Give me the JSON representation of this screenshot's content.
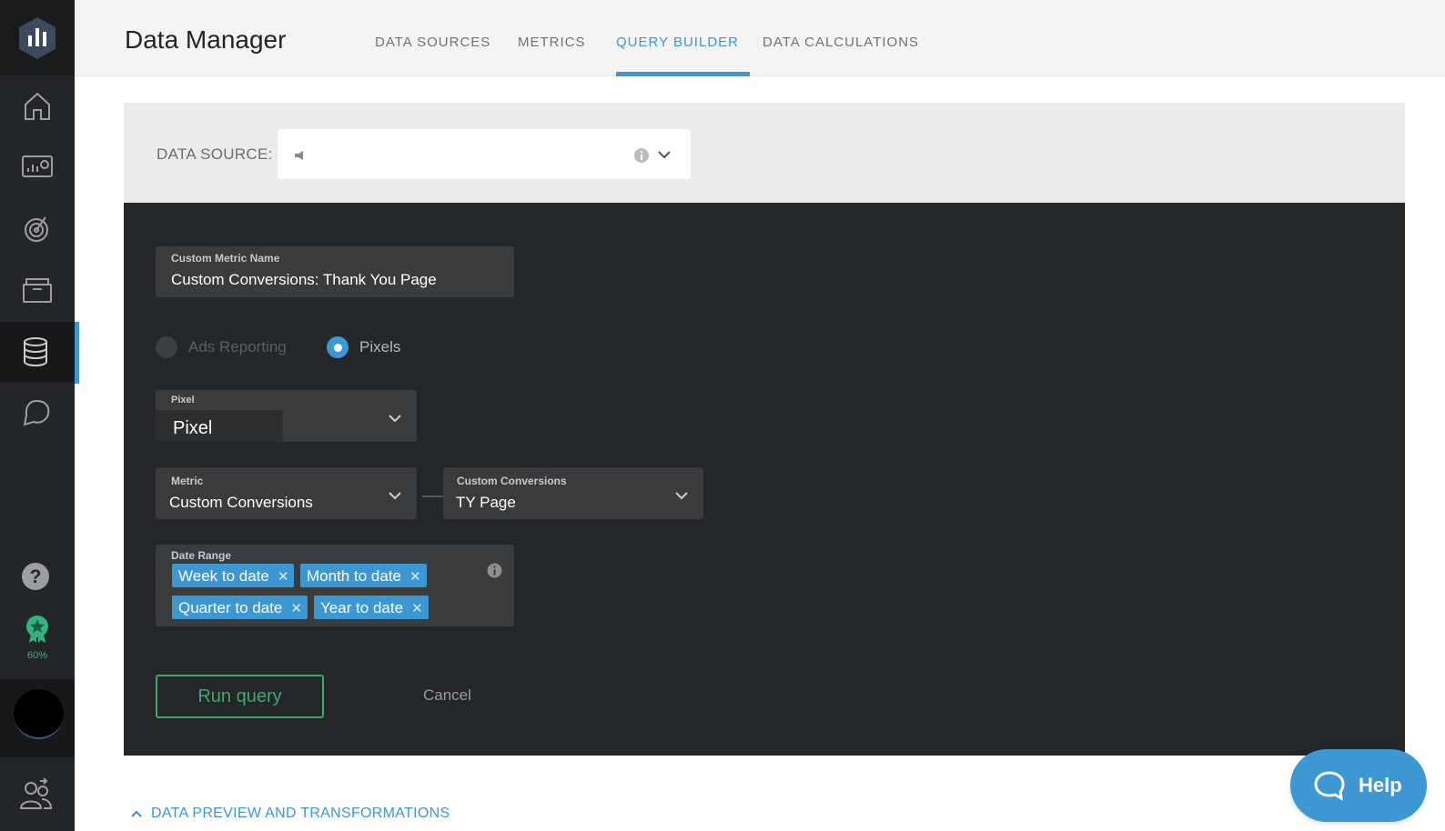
{
  "app": {
    "title": "Data Manager",
    "accent_color": "#3c97d3",
    "success_color": "#3fa86a"
  },
  "tabs": [
    {
      "label": "DATA SOURCES",
      "active": false
    },
    {
      "label": "METRICS",
      "active": false
    },
    {
      "label": "QUERY BUILDER",
      "active": true
    },
    {
      "label": "DATA CALCULATIONS",
      "active": false
    }
  ],
  "sidebar": {
    "items": [
      {
        "icon": "home-icon"
      },
      {
        "icon": "dashboard-icon"
      },
      {
        "icon": "goals-icon"
      },
      {
        "icon": "folder-icon"
      },
      {
        "icon": "database-icon",
        "active": true
      },
      {
        "icon": "alerts-icon"
      }
    ],
    "award_label": "60%",
    "award_progress": 0.6
  },
  "data_source": {
    "label": "DATA SOURCE:",
    "value_icon": "megaphone-icon"
  },
  "form": {
    "metric_name": {
      "label": "Custom Metric Name",
      "value": "Custom Conversions: Thank You Page"
    },
    "mode_options": [
      {
        "label": "Ads Reporting",
        "selected": false
      },
      {
        "label": "Pixels",
        "selected": true
      }
    ],
    "pixel": {
      "label": "Pixel",
      "value": "Pixel"
    },
    "metric": {
      "label": "Metric",
      "value": "Custom Conversions"
    },
    "custom_conversions": {
      "label": "Custom Conversions",
      "value": "TY Page"
    },
    "date_range": {
      "label": "Date Range",
      "chips": [
        "Week to date",
        "Month to date",
        "Quarter to date",
        "Year to date"
      ]
    },
    "run_label": "Run query",
    "cancel_label": "Cancel"
  },
  "footer": {
    "preview_label": "DATA PREVIEW AND TRANSFORMATIONS",
    "help_label": "Help"
  }
}
